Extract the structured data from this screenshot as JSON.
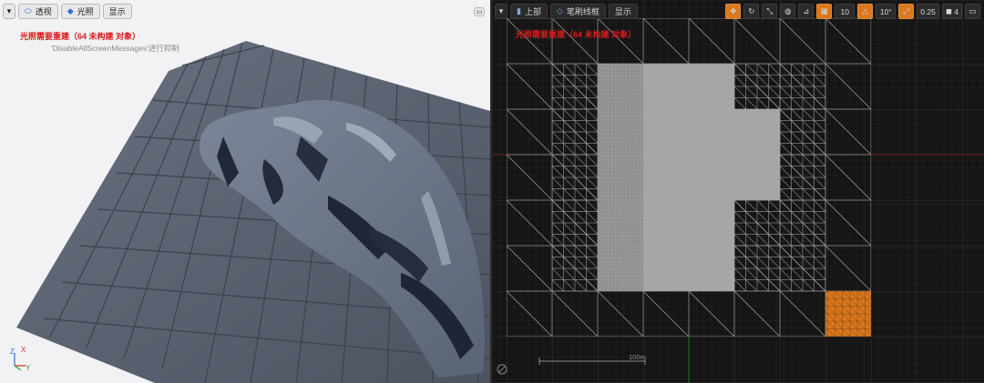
{
  "left_viewport": {
    "toolbar": {
      "perspective_label": "透视",
      "lit_label": "光照",
      "show_label": "显示"
    },
    "warning_text": "光照需要重建（64 未构建 对象）",
    "suppress_text": "'DisableAllScreenMessages'进行抑制",
    "axis": {
      "x": "X",
      "y": "Y",
      "z": "Z"
    }
  },
  "right_viewport": {
    "toolbar": {
      "view_label": "上部",
      "wireframe_label": "笔刷线框",
      "show_label": "显示",
      "grid_snap_value": "10",
      "rotate_snap_value": "10°",
      "scale_snap_value": "0.25",
      "camera_speed_value": "4"
    },
    "warning_text": "光照需要重建（64 未构建 对象）",
    "scale_label": "100m"
  },
  "colors": {
    "accent_orange": "#d9781e",
    "warning_red": "#d61c1c",
    "terrain_gray": "#5d6677"
  }
}
